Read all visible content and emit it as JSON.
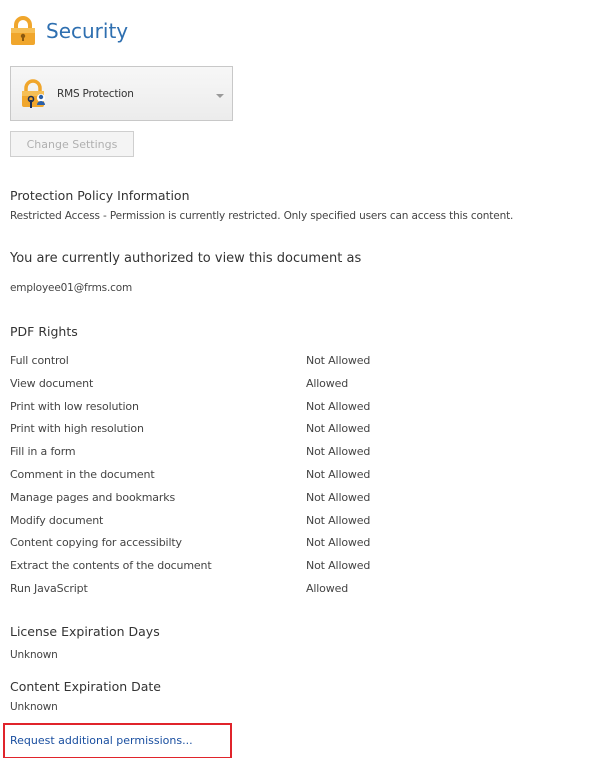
{
  "header": {
    "title": "Security",
    "icon": "lock-icon",
    "accent_color": "#2e6fb0",
    "lock_color": "#f0a62c"
  },
  "protection": {
    "selected": "RMS Protection",
    "icon": "rms-lock-icon"
  },
  "buttons": {
    "change_settings": "Change Settings"
  },
  "policy": {
    "heading": "Protection Policy Information",
    "description": "Restricted Access - Permission is currently restricted. Only specified users can access this content."
  },
  "authorization": {
    "heading": "You are currently authorized to view this document as",
    "user": "employee01@frms.com"
  },
  "rights": {
    "heading": "PDF Rights",
    "items": [
      {
        "name": "Full control",
        "value": "Not Allowed"
      },
      {
        "name": "View document",
        "value": "Allowed"
      },
      {
        "name": "Print with low resolution",
        "value": "Not Allowed"
      },
      {
        "name": "Print with high resolution",
        "value": "Not Allowed"
      },
      {
        "name": "Fill in a form",
        "value": "Not Allowed"
      },
      {
        "name": "Comment in the document",
        "value": "Not Allowed"
      },
      {
        "name": "Manage pages and bookmarks",
        "value": "Not Allowed"
      },
      {
        "name": "Modify document",
        "value": "Not Allowed"
      },
      {
        "name": "Content copying for accessibilty",
        "value": "Not Allowed"
      },
      {
        "name": "Extract the contents of the document",
        "value": "Not Allowed"
      },
      {
        "name": "Run JavaScript",
        "value": "Allowed"
      }
    ]
  },
  "license": {
    "heading": "License Expiration Days",
    "value": "Unknown"
  },
  "content_expiration": {
    "heading": "Content Expiration Date",
    "value": "Unknown"
  },
  "request": {
    "link_text": "Request additional permissions...",
    "highlight_color": "#e0242b"
  }
}
